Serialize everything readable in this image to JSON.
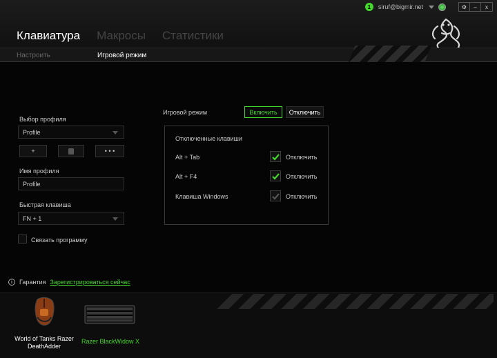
{
  "topbar": {
    "notification_count": "1",
    "email": "siruf@bigmir.net",
    "buttons": [
      "⚙",
      "–",
      "x"
    ]
  },
  "tabs": [
    {
      "label": "Клавиатура",
      "active": true
    },
    {
      "label": "Макросы",
      "active": false
    },
    {
      "label": "Статистики",
      "active": false
    }
  ],
  "subtabs": [
    {
      "label": "Настроить",
      "active": false
    },
    {
      "label": "Игровой режим",
      "active": true
    }
  ],
  "profile": {
    "select_label": "Выбор профиля",
    "selected": "Profile",
    "add_button": "+",
    "more_button": "• • •",
    "name_label": "Имя профиля",
    "name_value": "Profile",
    "hotkey_label": "Быстрая клавиша",
    "hotkey_value": "FN + 1",
    "link_program_label": "Связать программу"
  },
  "game_mode": {
    "label": "Игровой режим",
    "on_label": "Включить",
    "off_label": "Отключить",
    "state": "on",
    "disabled_keys_title": "Отключенные клавиши",
    "rows": [
      {
        "key": "Alt + Tab",
        "action": "Отключить",
        "checked": true,
        "enabled": true
      },
      {
        "key": "Alt + F4",
        "action": "Отключить",
        "checked": true,
        "enabled": true
      },
      {
        "key": "Клавиша Windows",
        "action": "Отключить",
        "checked": true,
        "enabled": false
      }
    ]
  },
  "warranty": {
    "label": "Гарантия",
    "link": "Зарегистрироваться сейчас"
  },
  "devices": [
    {
      "name": "World of Tanks Razer DeathAdder",
      "active": false
    },
    {
      "name": "Razer BlackWidow X",
      "active": true
    }
  ],
  "colors": {
    "accent": "#44d62c",
    "background": "#050505"
  }
}
